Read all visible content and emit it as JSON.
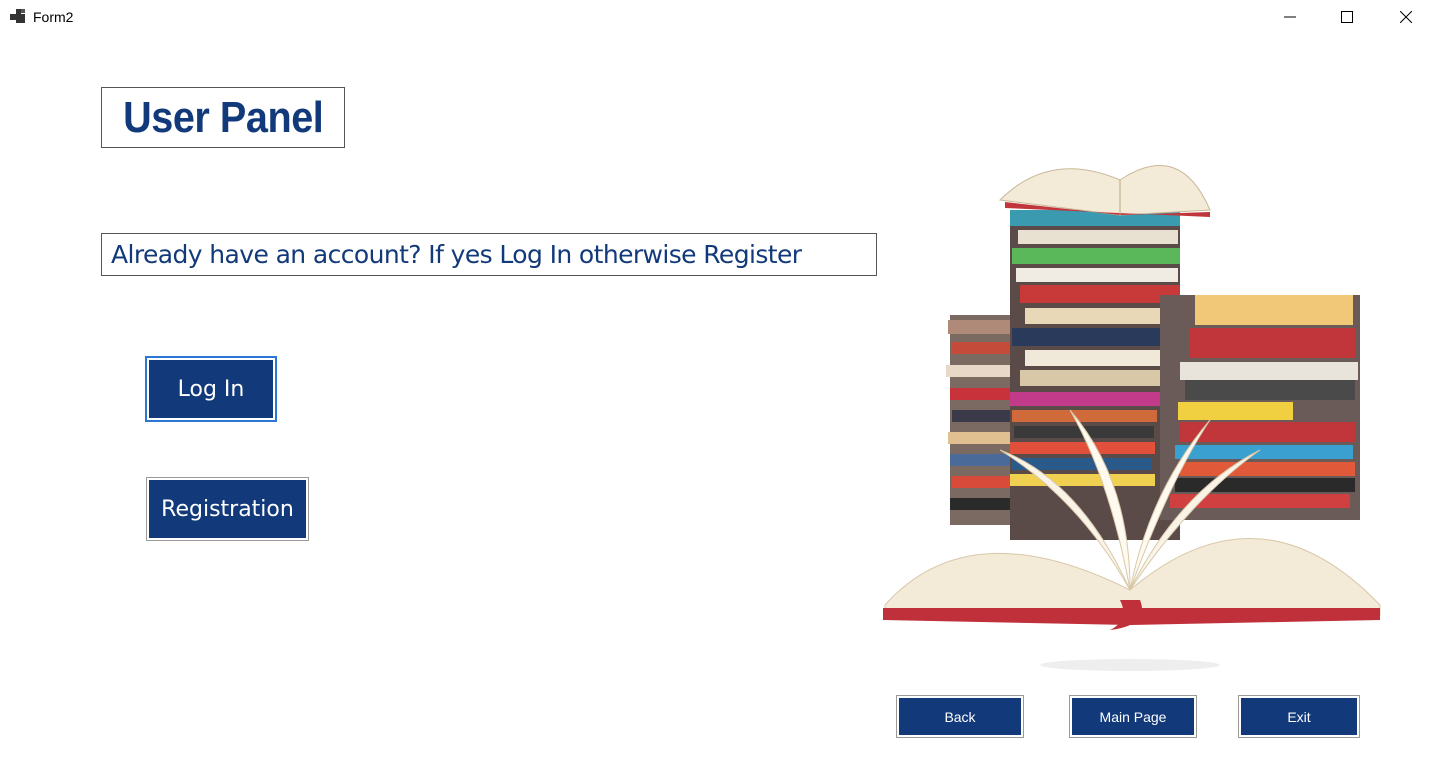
{
  "window": {
    "title": "Form2"
  },
  "header": {
    "title": "User Panel"
  },
  "prompt": {
    "text": "Already have an account? If yes Log In otherwise Register"
  },
  "actions": {
    "login_label": "Log In",
    "register_label": "Registration"
  },
  "footer": {
    "back_label": "Back",
    "main_label": "Main Page",
    "exit_label": "Exit"
  },
  "colors": {
    "accent": "#123a7a",
    "background": "#ffffff"
  },
  "image": {
    "subject": "stack-of-books-illustration"
  }
}
